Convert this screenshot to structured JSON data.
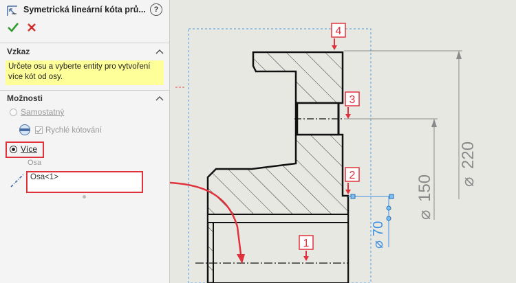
{
  "panel": {
    "title": "Symetrická lineární kóta prů...",
    "help_glyph": "?",
    "sections": {
      "message": {
        "heading": "Vzkaz",
        "text_line1": "Určete osu a vyberte entity pro vytvoření",
        "text_line2": "více kót od osy."
      },
      "options": {
        "heading": "Možnosti",
        "standalone_label": "Samostatný",
        "quick_dim_label": "Rychlé kótování",
        "multiple_label": "Více",
        "axis_label": "Osa",
        "axis_value": "Osa<1>"
      }
    }
  },
  "drawing": {
    "dimensions": {
      "d220": "220",
      "d150": "150",
      "d70": "70",
      "diameter_symbol": "⌀"
    },
    "markers": [
      "4",
      "3",
      "2",
      "1"
    ]
  },
  "colors": {
    "accent_red": "#e0323c",
    "ok_green": "#2e9b2e",
    "cancel_red": "#d42a2a",
    "dim_blue": "#3f8fe0",
    "dim_gray": "#8a8a8a",
    "message_bg": "#ffff99"
  },
  "icons": {
    "title": "symmetric-linear-dimension-icon",
    "help": "help-icon",
    "ok": "ok-check-icon",
    "cancel": "cancel-x-icon",
    "collapse": "chevron-up-icon",
    "quick_dim": "quick-dimension-icon",
    "axis": "axis-icon"
  }
}
